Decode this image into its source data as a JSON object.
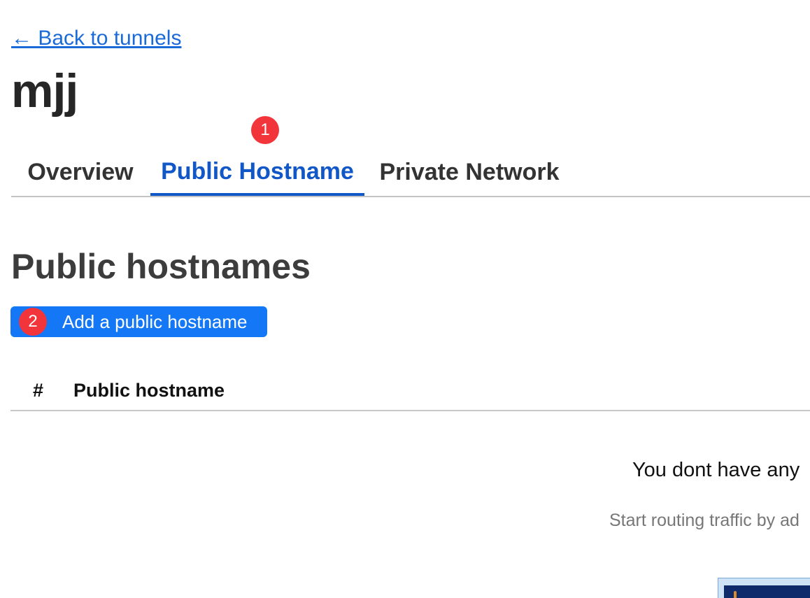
{
  "nav": {
    "back_link": "← Back to tunnels"
  },
  "tunnel": {
    "name": "mjj"
  },
  "annotations": {
    "marker_1": "1",
    "marker_2": "2",
    "marker_color": "#f2353b"
  },
  "tabs": [
    {
      "label": "Overview",
      "active": false
    },
    {
      "label": "Public Hostname",
      "active": true
    },
    {
      "label": "Private Network",
      "active": false
    }
  ],
  "section": {
    "title": "Public hostnames",
    "add_button_label": "Add a public hostname"
  },
  "table": {
    "columns": [
      "#",
      "Public hostname"
    ]
  },
  "empty_state": {
    "title": "You dont have any",
    "subtitle": "Start routing traffic by ad"
  },
  "colors": {
    "accent": "#1257c7",
    "button": "#1478f6",
    "link": "#1a6bd8"
  }
}
